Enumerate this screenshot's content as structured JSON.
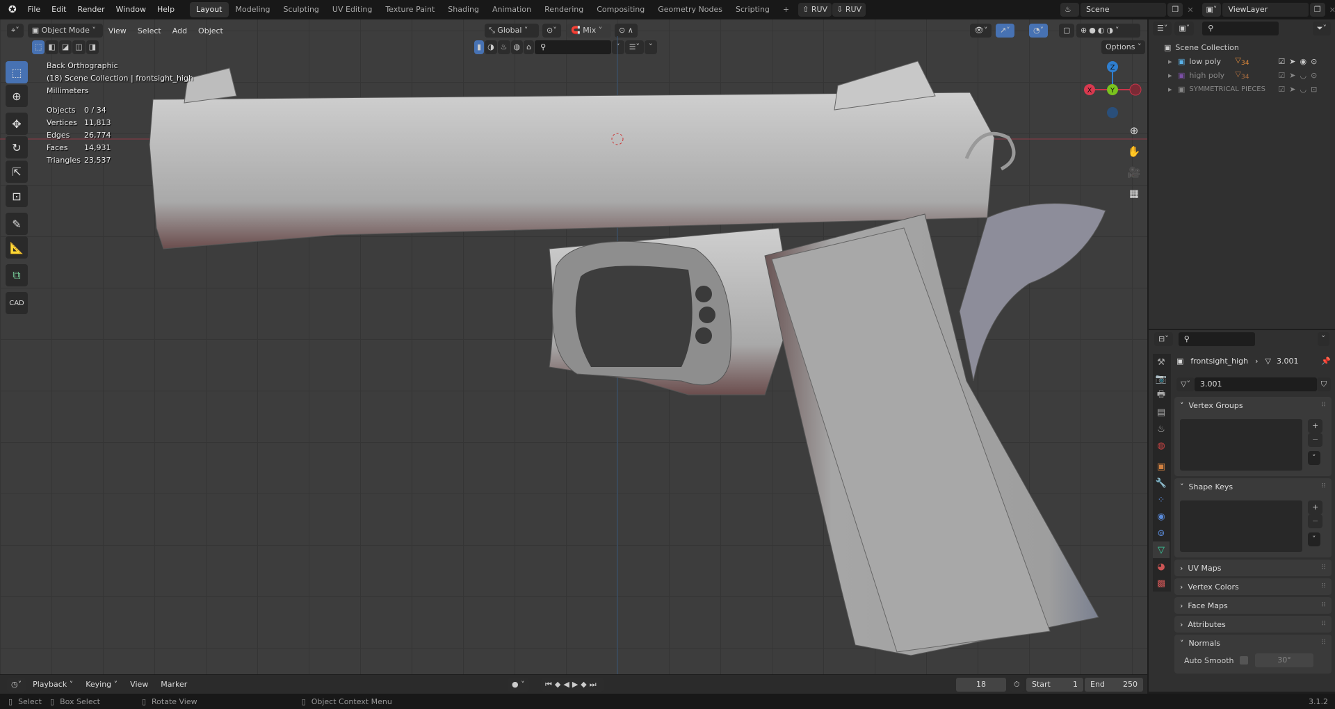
{
  "menubar": {
    "items": [
      "File",
      "Edit",
      "Render",
      "Window",
      "Help"
    ],
    "workspaces": [
      "Layout",
      "Modeling",
      "Sculpting",
      "UV Editing",
      "Texture Paint",
      "Shading",
      "Animation",
      "Rendering",
      "Compositing",
      "Geometry Nodes",
      "Scripting"
    ],
    "active_workspace": "Layout",
    "ruv_buttons": [
      "RUV",
      "RUV"
    ],
    "scene": "Scene",
    "view_layer": "ViewLayer"
  },
  "viewport": {
    "mode": "Object Mode",
    "menus": [
      "View",
      "Select",
      "Add",
      "Object"
    ],
    "orientation": "Global",
    "snap_mode": "Mix",
    "options_label": "Options",
    "overlay": {
      "view": "Back Orthographic",
      "collection": "(18) Scene Collection | frontsight_high",
      "units": "Millimeters",
      "stats": [
        {
          "label": "Objects",
          "value": "0 / 34"
        },
        {
          "label": "Vertices",
          "value": "11,813"
        },
        {
          "label": "Edges",
          "value": "26,774"
        },
        {
          "label": "Faces",
          "value": "14,931"
        },
        {
          "label": "Triangles",
          "value": "23,537"
        }
      ]
    },
    "gizmo": {
      "x": "X",
      "y": "Y",
      "z": "Z"
    },
    "tools": [
      "select-box",
      "cursor",
      "move",
      "rotate",
      "scale",
      "transform",
      "annotate",
      "measure",
      "add-cube",
      "CAD"
    ]
  },
  "outliner": {
    "root": "Scene Collection",
    "items": [
      {
        "name": "low poly",
        "count": "34",
        "color": "#5ab0e6"
      },
      {
        "name": "high poly",
        "count": "34",
        "color": "#7b4fa6"
      },
      {
        "name": "SYMMETRICAL PIECES",
        "color": "#888888"
      }
    ]
  },
  "properties": {
    "object": "frontsight_high",
    "mesh": "3.001",
    "datablock": "3.001",
    "panels": [
      {
        "label": "Vertex Groups",
        "open": true
      },
      {
        "label": "Shape Keys",
        "open": true
      },
      {
        "label": "UV Maps",
        "open": false
      },
      {
        "label": "Vertex Colors",
        "open": false
      },
      {
        "label": "Face Maps",
        "open": false
      },
      {
        "label": "Attributes",
        "open": false
      },
      {
        "label": "Normals",
        "open": true
      }
    ],
    "auto_smooth_label": "Auto Smooth",
    "auto_smooth_angle": "30°"
  },
  "timeline": {
    "menus": [
      "Playback",
      "Keying",
      "View",
      "Marker"
    ],
    "current_frame": "18",
    "start_label": "Start",
    "start": "1",
    "end_label": "End",
    "end": "250"
  },
  "statusbar": {
    "items": [
      "Select",
      "Box Select",
      "Rotate View",
      "Object Context Menu"
    ],
    "version": "3.1.2"
  }
}
